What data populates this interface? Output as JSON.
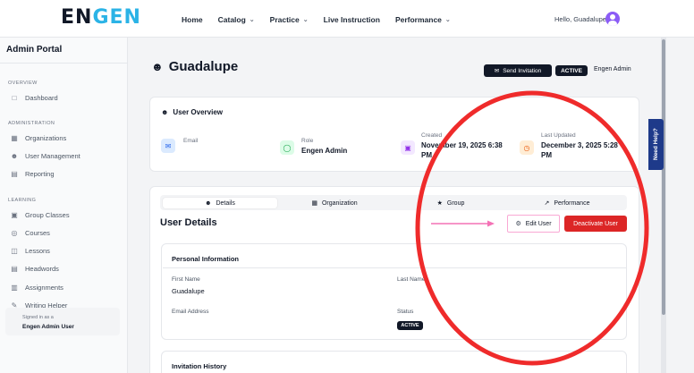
{
  "header": {
    "logo_part1": "EN",
    "logo_part2": "GEN",
    "nav": [
      {
        "label": "Home",
        "dropdown": false
      },
      {
        "label": "Catalog",
        "dropdown": true
      },
      {
        "label": "Practice",
        "dropdown": true
      },
      {
        "label": "Live Instruction",
        "dropdown": false
      },
      {
        "label": "Performance",
        "dropdown": true
      }
    ],
    "greeting": "Hello, Guadalupe"
  },
  "sidebar": {
    "title": "Admin Portal",
    "sections": [
      {
        "label": "OVERVIEW",
        "items": [
          {
            "label": "Dashboard",
            "icon": "chart-icon"
          }
        ]
      },
      {
        "label": "ADMINISTRATION",
        "items": [
          {
            "label": "Organizations",
            "icon": "building-icon"
          },
          {
            "label": "User Management",
            "icon": "users-icon"
          },
          {
            "label": "Reporting",
            "icon": "report-icon"
          }
        ]
      },
      {
        "label": "LEARNING",
        "items": [
          {
            "label": "Group Classes",
            "icon": "calendar-icon"
          },
          {
            "label": "Courses",
            "icon": "eye-icon"
          },
          {
            "label": "Lessons",
            "icon": "book-icon"
          },
          {
            "label": "Headwords",
            "icon": "list-icon"
          },
          {
            "label": "Assignments",
            "icon": "clipboard-icon"
          },
          {
            "label": "Writing Helper",
            "icon": "pen-icon"
          }
        ]
      }
    ],
    "signed_in_label": "Signed in as a",
    "signed_in_role": "Engen Admin User"
  },
  "main": {
    "title": "Guadalupe",
    "send_invitation": "Send Invitation",
    "status": "ACTIVE",
    "role_label": "Engen Admin",
    "overview": {
      "title": "User Overview",
      "email_label": "Email",
      "role_field_label": "Role",
      "role_value": "Engen Admin",
      "created_label": "Created",
      "created_value_l1": "November 19, 2025 6:38",
      "created_value_l2": "PM",
      "updated_label": "Last Updated",
      "updated_value_l1": "December 3, 2025 5:28",
      "updated_value_l2": "PM"
    },
    "help_tab": "Need Help?",
    "tabs": [
      "Details",
      "Organization",
      "Group",
      "Performance"
    ],
    "details_title": "User Details",
    "edit_user": "Edit User",
    "deactivate_user": "Deactivate User",
    "personal_info": {
      "title": "Personal Information",
      "first_name_label": "First Name",
      "first_name_value": "Guadalupe",
      "last_name_label": "Last Name",
      "email_label": "Email Address",
      "status_label": "Status",
      "status_value": "ACTIVE"
    },
    "invitation_history": "Invitation History"
  },
  "colors": {
    "accent_cyan": "#2bb3e6",
    "danger_red": "#dc2626",
    "annotation_red": "#ef2b2b",
    "highlight_pink": "#f472b6",
    "help_blue": "#1e3a8a"
  }
}
